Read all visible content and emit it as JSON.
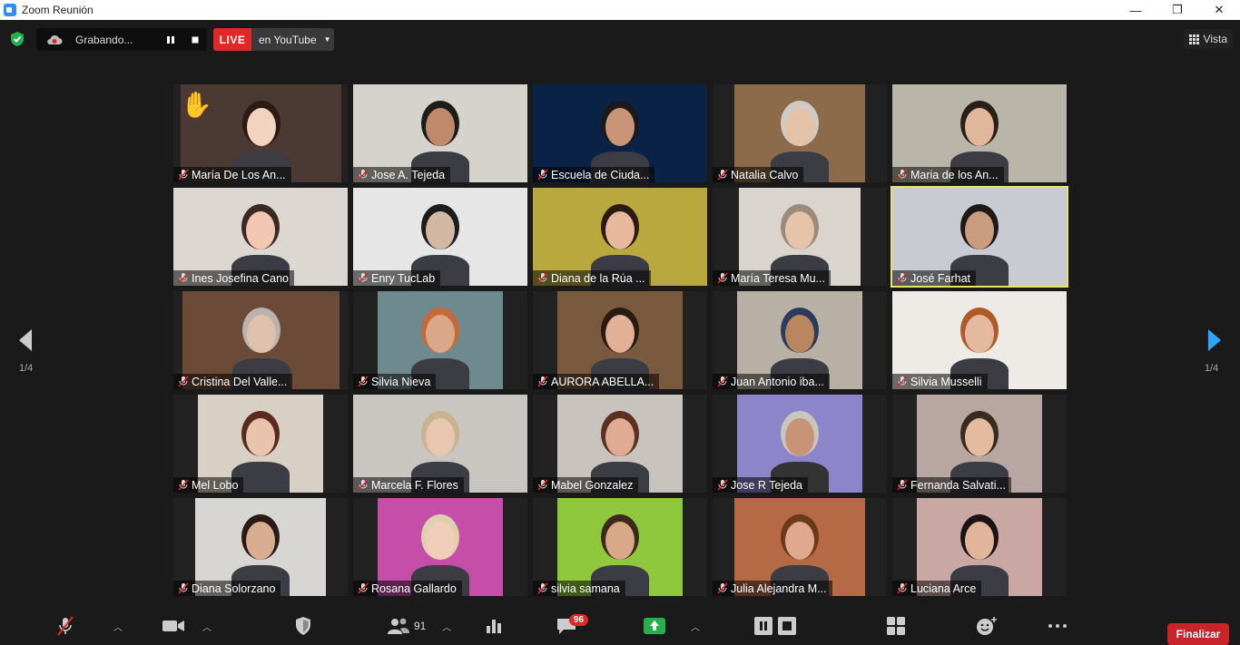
{
  "window": {
    "title": "Zoom Reunión",
    "minimize": "—",
    "restore": "❐",
    "close": "✕"
  },
  "topbar": {
    "recording_label": "Grabando...",
    "live_label": "LIVE",
    "live_target": "en YouTube",
    "view_label": "Vista",
    "pause_icon": "pause-icon",
    "stop_icon": "stop-icon"
  },
  "paging": {
    "left": "1/4",
    "right": "1/4"
  },
  "participants": [
    {
      "name": "María De Los An...",
      "bg": "#4a3a33",
      "person": "#f2d3c0",
      "hair": "#2a1b14",
      "hand": true
    },
    {
      "name": "Jose A. Tejeda",
      "bg": "#d6d2cc",
      "person": "#c08a6a",
      "hair": "#1c1c1c"
    },
    {
      "name": "Escuela de Ciuda...",
      "bg": "#0b2247",
      "person": "#c89578",
      "hair": "#1a1a1a"
    },
    {
      "name": "Natalia Calvo",
      "bg": "#8b6b4a",
      "person": "#e3c2a8",
      "hair": "#cfcac4"
    },
    {
      "name": "Maria de los An...",
      "bg": "#b9b5a8",
      "person": "#e0b79a",
      "hair": "#2a2018"
    },
    {
      "name": "Ines Josefina Cano",
      "bg": "#ddd7d2",
      "person": "#f1c7b2",
      "hair": "#3a2a22"
    },
    {
      "name": "Enry TucLab",
      "bg": "#e6e6e6",
      "person": "#d2b8a2",
      "hair": "#1c1c1c"
    },
    {
      "name": "Diana de la Rúa ...",
      "bg": "#b8a83e",
      "person": "#e8b89c",
      "hair": "#2b1b12"
    },
    {
      "name": "María Teresa Mu...",
      "bg": "#d9d4cd",
      "person": "#e6c4aa",
      "hair": "#9c8a7a"
    },
    {
      "name": "José Farhat",
      "bg": "#c8ccd2",
      "person": "#c99c80",
      "hair": "#1f1a17",
      "active": true
    },
    {
      "name": "Cristina Del Valle...",
      "bg": "#6b4a38",
      "person": "#e0c1ad",
      "hair": "#bbb3ab"
    },
    {
      "name": "Silvia Nieva",
      "bg": "#6f8a8e",
      "person": "#d9a889",
      "hair": "#c46a3a"
    },
    {
      "name": "AURORA ABELLA...",
      "bg": "#7a5a3f",
      "person": "#e2b096",
      "hair": "#2a1a12"
    },
    {
      "name": "Juan Antonio iba...",
      "bg": "#b8b0a5",
      "person": "#b9865f",
      "hair": "#2a3b5c"
    },
    {
      "name": "Silvia Musselli",
      "bg": "#eeeae6",
      "person": "#e3b9a0",
      "hair": "#b05a2a"
    },
    {
      "name": "Mel Lobo",
      "bg": "#d8d0c4",
      "person": "#e8c4ad",
      "hair": "#5a2a1f"
    },
    {
      "name": "Marcela F. Flores",
      "bg": "#c9c6c2",
      "person": "#e8c6b0",
      "hair": "#c8b38f"
    },
    {
      "name": "Mabel Gonzalez",
      "bg": "#c8c3bd",
      "person": "#e0ab92",
      "hair": "#5a3020"
    },
    {
      "name": "Jose R Tejeda",
      "bg": "#8d85c9",
      "person": "#c69474",
      "hair": "#c9c4be"
    },
    {
      "name": "Fernanda Salvati...",
      "bg": "#b7a6a2",
      "person": "#e4bb9f",
      "hair": "#3a2a1f"
    },
    {
      "name": "Diana Solorzano",
      "bg": "#d8d6d2",
      "person": "#d9ad92",
      "hair": "#2a1c14"
    },
    {
      "name": "Rosana Gallardo",
      "bg": "#c54fa8",
      "person": "#efcdb8",
      "hair": "#e0cfae"
    },
    {
      "name": "silvia samana",
      "bg": "#8fc83c",
      "person": "#d8a889",
      "hair": "#3a2a1c"
    },
    {
      "name": "Julia Alejandra M...",
      "bg": "#b56a45",
      "person": "#e0a98e",
      "hair": "#6a3a1a"
    },
    {
      "name": "Luciana Arce",
      "bg": "#c9a7a2",
      "person": "#e0b59c",
      "hair": "#1c1412"
    }
  ],
  "toolbar": {
    "participants_count": "91",
    "chat_badge": "96",
    "end_label": "Finalizar",
    "icons": [
      "mic-muted-icon",
      "video-icon",
      "security-icon",
      "participants-icon",
      "poll-icon",
      "chat-icon",
      "share-screen-icon",
      "pause-recording-icon",
      "breakout-rooms-icon",
      "reactions-icon",
      "more-icon"
    ]
  },
  "colors": {
    "live": "#e02828",
    "active_speaker": "#e8e26a",
    "share": "#22b14c",
    "end": "#c8242a",
    "arrow": "#2da6ff"
  }
}
